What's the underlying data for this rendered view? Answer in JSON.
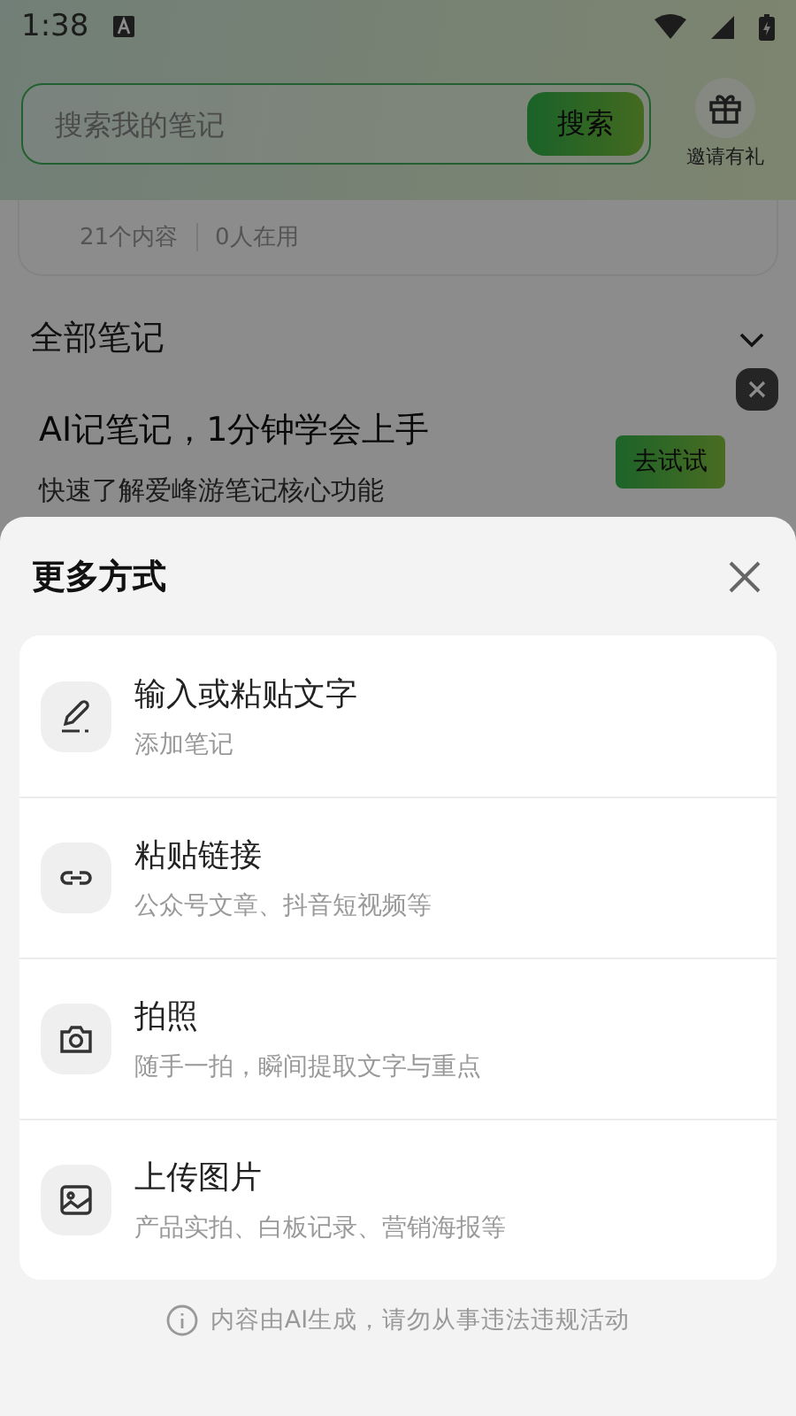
{
  "status_bar": {
    "time": "1:38"
  },
  "header": {
    "search": {
      "placeholder": "搜索我的笔记",
      "button": "搜索"
    },
    "invite": {
      "label": "邀请有礼"
    }
  },
  "stats_card": {
    "items": [
      "21个内容",
      "0人在用"
    ]
  },
  "section": {
    "title": "全部笔记",
    "expanded": false
  },
  "promo": {
    "title": "AI记笔记，1分钟学会上手",
    "subtitle": "快速了解爱峰游笔记核心功能",
    "button": "去试试"
  },
  "sheet": {
    "title": "更多方式",
    "methods": [
      {
        "kind": "text",
        "title": "输入或粘贴文字",
        "subtitle": "添加笔记"
      },
      {
        "kind": "link",
        "title": "粘贴链接",
        "subtitle": "公众号文章、抖音短视频等"
      },
      {
        "kind": "camera",
        "title": "拍照",
        "subtitle": "随手一拍，瞬间提取文字与重点"
      },
      {
        "kind": "image",
        "title": "上传图片",
        "subtitle": "产品实拍、白板记录、营销海报等"
      }
    ],
    "disclaimer": "内容由AI生成，请勿从事违法违规活动"
  }
}
